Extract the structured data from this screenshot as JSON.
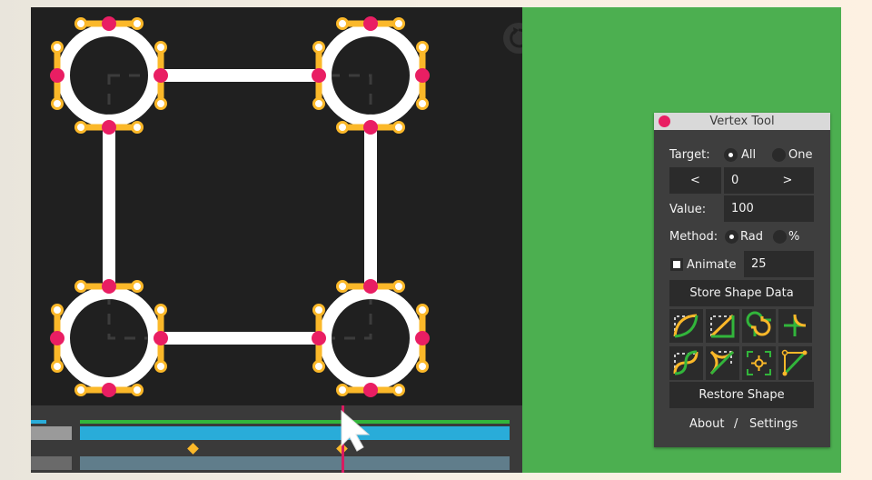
{
  "colors": {
    "canvas_bg": "#202020",
    "shape_fill": "#ffffff",
    "anchor": "#e91e63",
    "handle": "#fbb829",
    "green_screen": "#4caf50",
    "timeline_green": "#32b53b",
    "timeline_blue": "#29acd9",
    "timeline_slate": "#607d8b",
    "playhead": "#d81b60"
  },
  "canvas": {
    "reset_icon": "reset-rotate-icon"
  },
  "timeline": {
    "playhead_position_fraction": 0.61,
    "keyframes_fraction": [
      0.265,
      0.61
    ]
  },
  "vertex_tool": {
    "title": "Vertex Tool",
    "target_label": "Target:",
    "target_options": [
      "All",
      "One"
    ],
    "target_selected": "All",
    "prev_label": "<",
    "index_value": "0",
    "next_label": ">",
    "value_label": "Value:",
    "value": "100",
    "method_label": "Method:",
    "method_options": [
      "Rad",
      "%"
    ],
    "method_selected": "Rad",
    "animate_label": "Animate",
    "animate_checked": true,
    "animate_value": "25",
    "store_label": "Store Shape Data",
    "tool_icons": [
      "round-corner-icon",
      "diagonal-corner-icon",
      "loop-corner-icon",
      "inverted-corner-icon",
      "twist-corner-icon",
      "star-corner-icon",
      "center-anchor-icon",
      "handle-path-icon"
    ],
    "restore_label": "Restore Shape",
    "about_label": "About",
    "separator": "/",
    "settings_label": "Settings"
  }
}
